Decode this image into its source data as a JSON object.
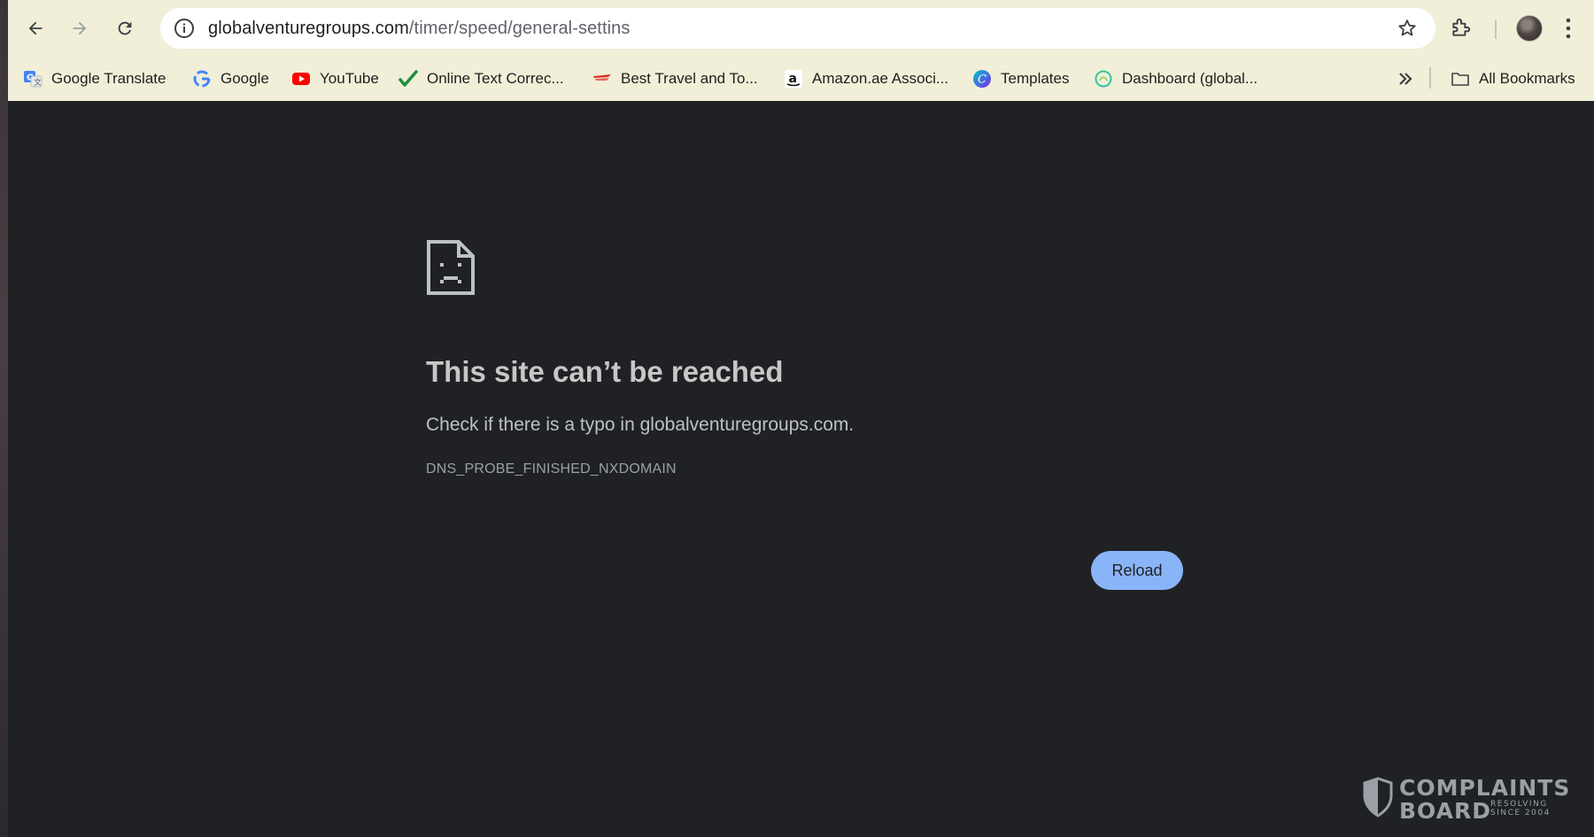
{
  "browser": {
    "url_host": "globalventuregroups.com",
    "url_path": "/timer/speed/general-settins"
  },
  "icons": {
    "back": "arrow-left-icon",
    "forward": "arrow-right-icon",
    "reload": "refresh-icon",
    "site_info": "info-icon",
    "bookmark": "star-icon",
    "extensions": "puzzle-icon",
    "menu": "vertical-dots-icon",
    "overflow": "double-chevron-icon",
    "folder": "folder-icon",
    "error": "sad-page-icon"
  },
  "bookmarks": {
    "items": [
      {
        "label": "Google Translate",
        "icon": "translate-icon"
      },
      {
        "label": "Google",
        "icon": "google-icon"
      },
      {
        "label": "YouTube",
        "icon": "youtube-icon"
      },
      {
        "label": "Online Text Correc...",
        "icon": "checkmark-icon"
      },
      {
        "label": "Best Travel and To...",
        "icon": "flag-icon"
      },
      {
        "label": "Amazon.ae Associ...",
        "icon": "amazon-icon"
      },
      {
        "label": "Templates",
        "icon": "canva-icon"
      },
      {
        "label": "Dashboard (global...",
        "icon": "dashboard-icon"
      }
    ],
    "all_bookmarks": "All Bookmarks"
  },
  "error_page": {
    "title": "This site can’t be reached",
    "description": "Check if there is a typo in globalventuregroups.com.",
    "code": "DNS_PROBE_FINISHED_NXDOMAIN",
    "reload_label": "Reload"
  },
  "watermark": {
    "line1": "COMPLAINTS",
    "line2": "BOARD",
    "tag1": "RESOLVING",
    "tag2": "SINCE 2004"
  },
  "colors": {
    "page_bg": "#202124",
    "chrome_bg": "#f1efd8",
    "button_bg": "#8ab4f8",
    "youtube_red": "#ff0000"
  }
}
